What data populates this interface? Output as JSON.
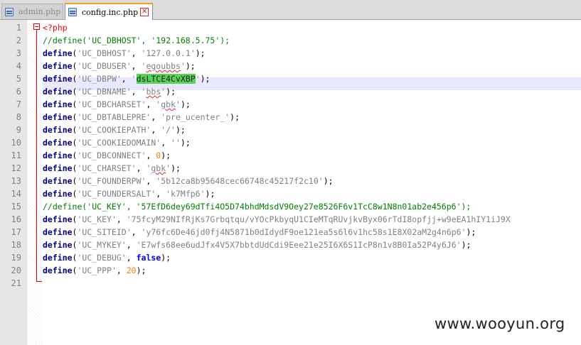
{
  "tabs": [
    {
      "label": "admin.php",
      "active": false
    },
    {
      "label": "config.inc.php",
      "active": true
    }
  ],
  "lines": [
    {
      "n": "1",
      "tokens": [
        {
          "t": "<?php",
          "c": "php"
        }
      ]
    },
    {
      "n": "2",
      "tokens": [
        {
          "t": "//define('UC_DBHOST', '192.168.5.75');",
          "c": "cm"
        }
      ]
    },
    {
      "n": "3",
      "tokens": [
        {
          "t": "define",
          "c": "kw"
        },
        {
          "t": "(",
          "c": ""
        },
        {
          "t": "'UC_DBHOST'",
          "c": "str"
        },
        {
          "t": ", ",
          "c": ""
        },
        {
          "t": "'127.0.0.1'",
          "c": "str"
        },
        {
          "t": ");",
          "c": ""
        }
      ]
    },
    {
      "n": "4",
      "tokens": [
        {
          "t": "define",
          "c": "kw"
        },
        {
          "t": "(",
          "c": ""
        },
        {
          "t": "'UC_DBUSER'",
          "c": "str"
        },
        {
          "t": ", ",
          "c": ""
        },
        {
          "t": "'",
          "c": "str"
        },
        {
          "t": "egoubbs",
          "c": "str squig"
        },
        {
          "t": "'",
          "c": "str"
        },
        {
          "t": ");",
          "c": ""
        }
      ]
    },
    {
      "n": "5",
      "tokens": [
        {
          "t": "define",
          "c": "kw"
        },
        {
          "t": "(",
          "c": ""
        },
        {
          "t": "'UC_DBPW'",
          "c": "str"
        },
        {
          "t": ", ",
          "c": ""
        },
        {
          "t": "'",
          "c": "str"
        },
        {
          "t": "dsLTCE4CvXBP",
          "c": "hl"
        },
        {
          "t": "'",
          "c": "str"
        },
        {
          "t": ");",
          "c": ""
        }
      ]
    },
    {
      "n": "6",
      "tokens": [
        {
          "t": "define",
          "c": "kw"
        },
        {
          "t": "(",
          "c": ""
        },
        {
          "t": "'UC_DBNAME'",
          "c": "str"
        },
        {
          "t": ", ",
          "c": ""
        },
        {
          "t": "'",
          "c": "str"
        },
        {
          "t": "bbs",
          "c": "str squig"
        },
        {
          "t": "'",
          "c": "str"
        },
        {
          "t": ");",
          "c": ""
        }
      ]
    },
    {
      "n": "7",
      "tokens": [
        {
          "t": "define",
          "c": "kw"
        },
        {
          "t": "(",
          "c": ""
        },
        {
          "t": "'UC_DBCHARSET'",
          "c": "str"
        },
        {
          "t": ", ",
          "c": ""
        },
        {
          "t": "'",
          "c": "str"
        },
        {
          "t": "gbk",
          "c": "str squig"
        },
        {
          "t": "'",
          "c": "str"
        },
        {
          "t": ");",
          "c": ""
        }
      ]
    },
    {
      "n": "8",
      "tokens": [
        {
          "t": "define",
          "c": "kw"
        },
        {
          "t": "(",
          "c": ""
        },
        {
          "t": "'UC_DBTABLEPRE'",
          "c": "str"
        },
        {
          "t": ", ",
          "c": ""
        },
        {
          "t": "'pre_ucenter_'",
          "c": "str"
        },
        {
          "t": ");",
          "c": ""
        }
      ]
    },
    {
      "n": "9",
      "tokens": [
        {
          "t": "define",
          "c": "kw"
        },
        {
          "t": "(",
          "c": ""
        },
        {
          "t": "'UC_COOKIEPATH'",
          "c": "str"
        },
        {
          "t": ", ",
          "c": ""
        },
        {
          "t": "'/'",
          "c": "str"
        },
        {
          "t": ");",
          "c": ""
        }
      ]
    },
    {
      "n": "10",
      "tokens": [
        {
          "t": "define",
          "c": "kw"
        },
        {
          "t": "(",
          "c": ""
        },
        {
          "t": "'UC_COOKIEDOMAIN'",
          "c": "str"
        },
        {
          "t": ", ",
          "c": ""
        },
        {
          "t": "''",
          "c": "str"
        },
        {
          "t": ");",
          "c": ""
        }
      ]
    },
    {
      "n": "11",
      "tokens": [
        {
          "t": "define",
          "c": "kw"
        },
        {
          "t": "(",
          "c": ""
        },
        {
          "t": "'UC_DBCONNECT'",
          "c": "str"
        },
        {
          "t": ", ",
          "c": ""
        },
        {
          "t": "0",
          "c": "num"
        },
        {
          "t": ");",
          "c": ""
        }
      ]
    },
    {
      "n": "12",
      "tokens": [
        {
          "t": "define",
          "c": "kw"
        },
        {
          "t": "(",
          "c": ""
        },
        {
          "t": "'UC_CHARSET'",
          "c": "str"
        },
        {
          "t": ", ",
          "c": ""
        },
        {
          "t": "'",
          "c": "str"
        },
        {
          "t": "gbk",
          "c": "str squig"
        },
        {
          "t": "'",
          "c": "str"
        },
        {
          "t": ");",
          "c": ""
        }
      ]
    },
    {
      "n": "13",
      "tokens": [
        {
          "t": "define",
          "c": "kw"
        },
        {
          "t": "(",
          "c": ""
        },
        {
          "t": "'UC_FOUNDERPW'",
          "c": "str"
        },
        {
          "t": ", ",
          "c": ""
        },
        {
          "t": "'5b12ca8b95648cec66748c45217f2c10'",
          "c": "str"
        },
        {
          "t": ");",
          "c": ""
        }
      ]
    },
    {
      "n": "14",
      "tokens": [
        {
          "t": "define",
          "c": "kw"
        },
        {
          "t": "(",
          "c": ""
        },
        {
          "t": "'UC_FOUNDERSALT'",
          "c": "str"
        },
        {
          "t": ", ",
          "c": ""
        },
        {
          "t": "'k7Mfp6'",
          "c": "str"
        },
        {
          "t": ");",
          "c": ""
        }
      ]
    },
    {
      "n": "15",
      "tokens": [
        {
          "t": "//define('UC_KEY', '57EfD6dey69dTfi4O5D74bhdMdsdV9Oey27e8526F6v1TcC8w1N8n01ab2e456p6');",
          "c": "cm"
        }
      ]
    },
    {
      "n": "16",
      "tokens": [
        {
          "t": "define",
          "c": "kw"
        },
        {
          "t": "(",
          "c": ""
        },
        {
          "t": "'UC_KEY'",
          "c": "str"
        },
        {
          "t": ", ",
          "c": ""
        },
        {
          "t": "'75fcyM29NIfRjKs7Grbqtqu/vYOcPkbyqU1CIeMTqRUvjkvByx06rTdI8opfjj+w9eEA1hIY1iJ9X",
          "c": "str"
        }
      ]
    },
    {
      "n": "17",
      "tokens": [
        {
          "t": "define",
          "c": "kw"
        },
        {
          "t": "(",
          "c": ""
        },
        {
          "t": "'UC_SITEID'",
          "c": "str"
        },
        {
          "t": ", ",
          "c": ""
        },
        {
          "t": "'y76fc6De46jd0fj4N5871b0dIdydF9oe121ea5s6l6v1hc58s1E8X02aM2g4n6p6'",
          "c": "str"
        },
        {
          "t": ");",
          "c": ""
        }
      ]
    },
    {
      "n": "18",
      "tokens": [
        {
          "t": "define",
          "c": "kw"
        },
        {
          "t": "(",
          "c": ""
        },
        {
          "t": "'UC_MYKEY'",
          "c": "str"
        },
        {
          "t": ", ",
          "c": ""
        },
        {
          "t": "'E7wfs68ee6udJfx4V5X7bbtdUdCdi9Eee21e25I6X6S1IcP8n1v8B0Ia52P4y6J6'",
          "c": "str"
        },
        {
          "t": ");",
          "c": ""
        }
      ]
    },
    {
      "n": "19",
      "tokens": [
        {
          "t": "define",
          "c": "kw"
        },
        {
          "t": "(",
          "c": ""
        },
        {
          "t": "'UC_DEBUG'",
          "c": "str"
        },
        {
          "t": ", ",
          "c": ""
        },
        {
          "t": "false",
          "c": "kw2"
        },
        {
          "t": ");",
          "c": ""
        }
      ]
    },
    {
      "n": "20",
      "tokens": [
        {
          "t": "define",
          "c": "kw"
        },
        {
          "t": "(",
          "c": ""
        },
        {
          "t": "'UC_PPP'",
          "c": "str"
        },
        {
          "t": ", ",
          "c": ""
        },
        {
          "t": "20",
          "c": "num"
        },
        {
          "t": ");",
          "c": ""
        }
      ]
    },
    {
      "n": "21",
      "tokens": []
    }
  ],
  "watermark": "www.wooyun.org",
  "colors": {
    "keyword": "#000080",
    "string": "#808080",
    "number": "#ff8000",
    "comment": "#008000",
    "php_tag": "#ff0000",
    "selection": "#5ad25a",
    "current_line": "#e8e8ff",
    "active_tab_accent": "#f5a020"
  },
  "icons": [
    "php-file-icon",
    "close-tab-icon",
    "fold-marker-icon"
  ]
}
